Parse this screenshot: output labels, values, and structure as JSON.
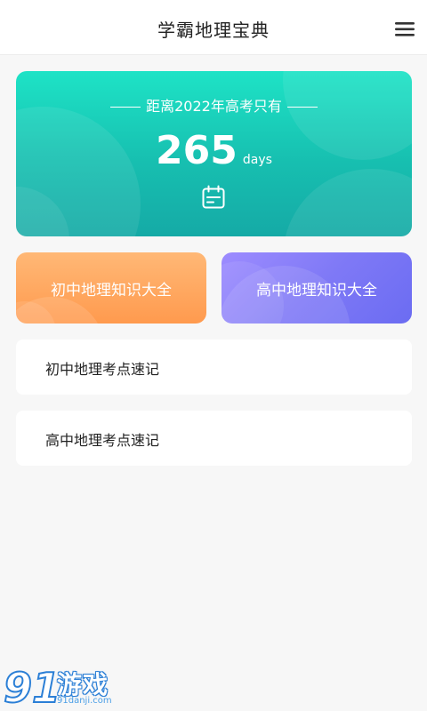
{
  "header": {
    "title": "学霸地理宝典",
    "menu_icon": "hamburger-menu-icon"
  },
  "countdown": {
    "title": "距离2022年高考只有",
    "days": "265",
    "unit": "days",
    "icon": "calendar-icon",
    "gradient": [
      "#1ee3c6",
      "#15aaa6"
    ]
  },
  "cards": [
    {
      "label": "初中地理知识大全",
      "color": "#ffa45e"
    },
    {
      "label": "高中地理知识大全",
      "color": "#7f79f6"
    }
  ],
  "list": [
    {
      "label": "初中地理考点速记"
    },
    {
      "label": "高中地理考点速记"
    }
  ],
  "watermark": {
    "brand": "游戏",
    "url": "91danji.com",
    "logo_text": "91"
  }
}
